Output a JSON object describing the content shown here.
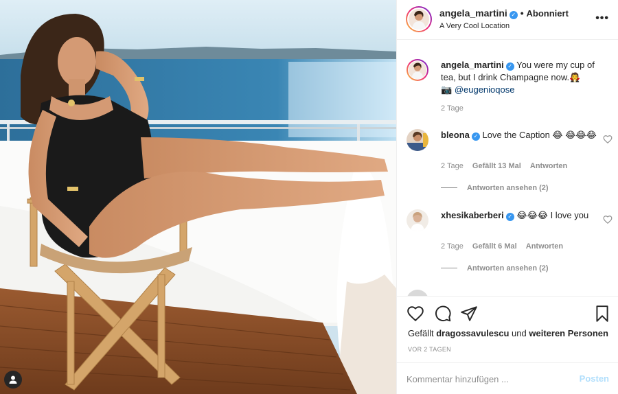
{
  "post": {
    "username": "angela_martini",
    "follow_separator": "•",
    "follow_state": "Abonniert",
    "location": "A Very Cool Location",
    "more_icon": "more-horizontal-icon",
    "more_label": "•••"
  },
  "caption": {
    "username": "angela_martini",
    "text": "You were my cup of tea, but I drink Champagne now.🧛",
    "photo_credit_emoji": "📷",
    "mention": "@eugenioqose",
    "time": "2 Tage"
  },
  "comments": [
    {
      "username": "bleona",
      "text": "Love the Caption 😂 😂😂😂",
      "time": "2 Tage",
      "likes": "Gefällt 13 Mal",
      "reply_label": "Antworten",
      "view_replies": "Antworten ansehen (2)"
    },
    {
      "username": "xhesikaberberi",
      "text": "😂😂😂 I love you",
      "time": "2 Tage",
      "likes": "Gefällt 6 Mal",
      "reply_label": "Antworten",
      "view_replies": "Antworten ansehen (2)"
    }
  ],
  "actions": {
    "icons": [
      "heart-icon",
      "comment-icon",
      "share-icon",
      "bookmark-icon"
    ],
    "likes_prefix": "Gefällt",
    "likes_user": "dragossavulescu",
    "likes_conj": "und",
    "likes_rest": "weiteren Personen",
    "date": "VOR 2 TAGEN"
  },
  "add_comment": {
    "placeholder": "Kommentar hinzufügen ...",
    "post_label": "Posten"
  },
  "colors": {
    "verified": "#3897f0",
    "mention": "#00376b",
    "post_button_disabled": "#b2dffc",
    "meta_text": "#8e8e8e"
  }
}
